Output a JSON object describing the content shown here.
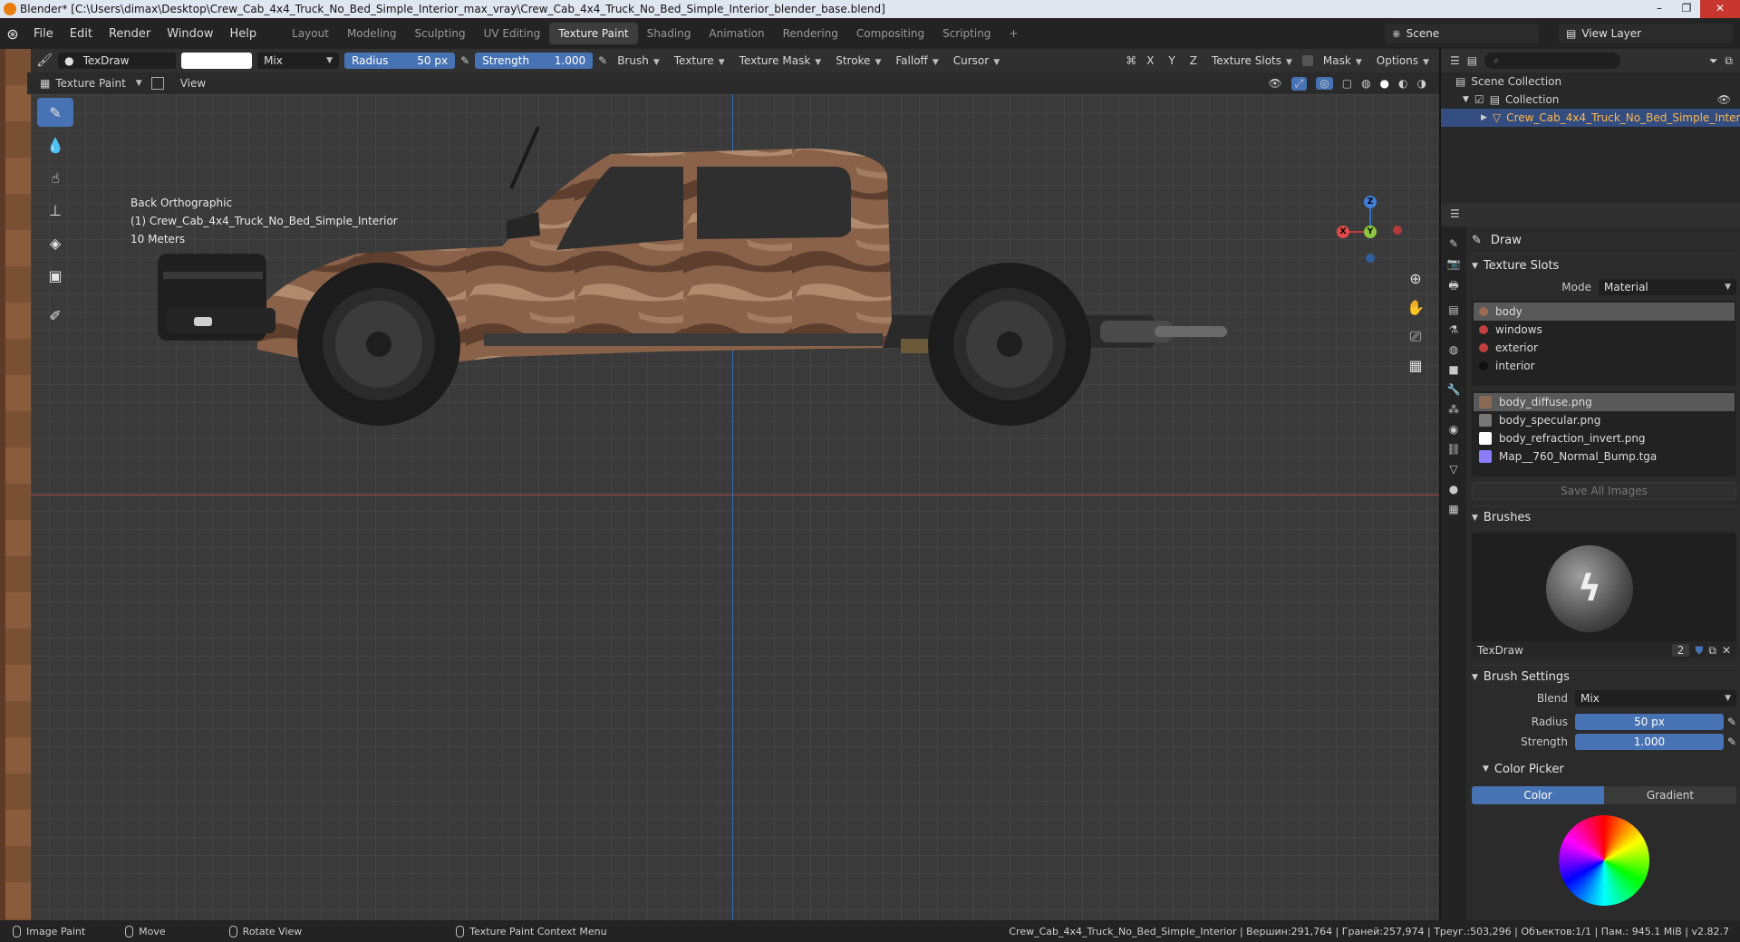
{
  "window": {
    "title": "Blender* [C:\\Users\\dimax\\Desktop\\Crew_Cab_4x4_Truck_No_Bed_Simple_Interior_max_vray\\Crew_Cab_4x4_Truck_No_Bed_Simple_Interior_blender_base.blend]"
  },
  "menu": [
    "File",
    "Edit",
    "Render",
    "Window",
    "Help"
  ],
  "workspaces": [
    "Layout",
    "Modeling",
    "Sculpting",
    "UV Editing",
    "Texture Paint",
    "Shading",
    "Animation",
    "Rendering",
    "Compositing",
    "Scripting",
    "+"
  ],
  "scene": {
    "name": "Scene",
    "view_layer": "View Layer"
  },
  "tool_header": {
    "brush_name": "TexDraw",
    "color": "#ffffff",
    "blend": "Mix",
    "radius_label": "Radius",
    "radius_value": "50 px",
    "strength_label": "Strength",
    "strength_value": "1.000",
    "menus": [
      "Brush",
      "Texture",
      "Texture Mask",
      "Stroke",
      "Falloff",
      "Cursor"
    ],
    "axes": [
      "X",
      "Y",
      "Z"
    ],
    "right": [
      "Texture Slots",
      "Mask",
      "Options"
    ]
  },
  "sub_header": {
    "mode": "Texture Paint",
    "view": "View"
  },
  "viewport": {
    "view_name": "Back Orthographic",
    "object": "(1) Crew_Cab_4x4_Truck_No_Bed_Simple_Interior",
    "scale": "10 Meters",
    "gizmo": {
      "z": "Z",
      "y": "Y",
      "x": "X"
    }
  },
  "outliner": {
    "scene_collection": "Scene Collection",
    "collection": "Collection",
    "object": "Crew_Cab_4x4_Truck_No_Bed_Simple_Inter"
  },
  "properties": {
    "tool_name": "Draw",
    "texture_slots": {
      "title": "Texture Slots",
      "mode_label": "Mode",
      "mode_value": "Material",
      "materials": [
        {
          "name": "body",
          "color": "#9b6b52"
        },
        {
          "name": "windows",
          "color": "#c04040"
        },
        {
          "name": "exterior",
          "color": "#c04040"
        },
        {
          "name": "interior",
          "color": "#111111"
        }
      ],
      "images": [
        {
          "name": "body_diffuse.png",
          "color": "#8a6a52"
        },
        {
          "name": "body_specular.png",
          "color": "#777777"
        },
        {
          "name": "body_refraction_invert.png",
          "color": "#ffffff"
        },
        {
          "name": "Map__760_Normal_Bump.tga",
          "color": "#8a7dff"
        }
      ],
      "save_all": "Save All Images"
    },
    "brushes": {
      "title": "Brushes",
      "brush_name": "TexDraw",
      "users": "2"
    },
    "brush_settings": {
      "title": "Brush Settings",
      "blend_label": "Blend",
      "blend_value": "Mix",
      "radius_label": "Radius",
      "radius_value": "50 px",
      "strength_label": "Strength",
      "strength_value": "1.000"
    },
    "color_picker": {
      "title": "Color Picker",
      "tabs": [
        "Color",
        "Gradient"
      ]
    }
  },
  "statusbar": {
    "hints": [
      "Image Paint",
      "Move",
      "Rotate View",
      "Texture Paint Context Menu"
    ],
    "stats": "Crew_Cab_4x4_Truck_No_Bed_Simple_Interior | Вершин:291,764 | Граней:257,974 | Треуг.:503,296 | Объектов:1/1 | Пам.: 945.1 MiB | v2.82.7"
  }
}
